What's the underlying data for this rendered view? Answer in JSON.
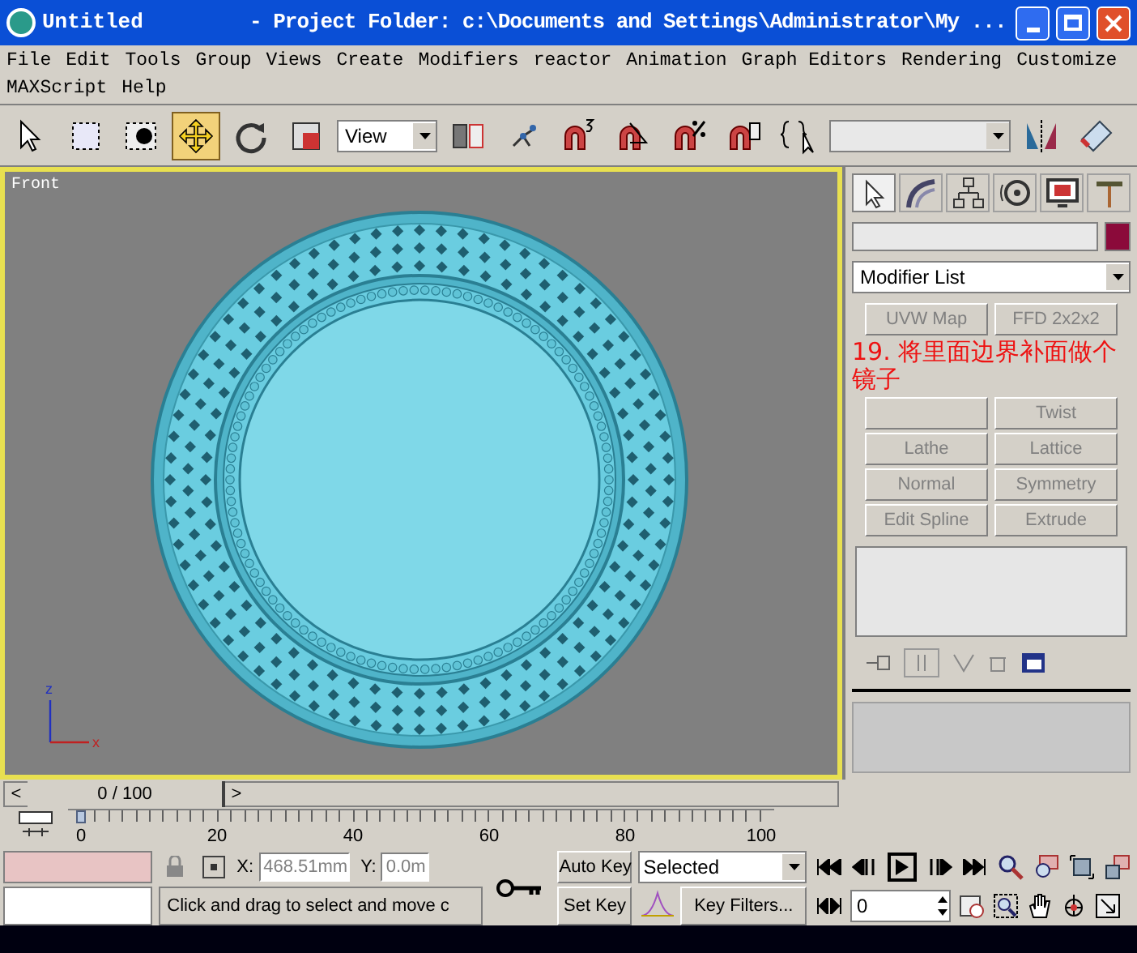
{
  "window": {
    "title": "Untitled",
    "project_folder": "- Project Folder: c:\\Documents and Settings\\Administrator\\My ..."
  },
  "menu_rows": [
    [
      "File",
      "Edit",
      "Tools",
      "Group",
      "Views",
      "Create",
      "Modifiers",
      "reactor",
      "Animation",
      "Graph Editors",
      "Rendering",
      "Customize"
    ],
    [
      "MAXScript",
      "Help"
    ]
  ],
  "toolbar": {
    "tools": [
      {
        "kind": "select",
        "selected": false
      },
      {
        "kind": "region",
        "selected": false
      },
      {
        "kind": "by-name",
        "selected": false
      },
      {
        "kind": "move",
        "selected": true
      },
      {
        "kind": "rotate",
        "selected": false
      },
      {
        "kind": "scale",
        "selected": false
      },
      {
        "kind": "coord"
      },
      {
        "kind": "pivot",
        "selected": false
      },
      {
        "kind": "link",
        "selected": false
      },
      {
        "kind": "snap3",
        "selected": false
      },
      {
        "kind": "angle-snap",
        "selected": false
      },
      {
        "kind": "percent-snap",
        "selected": false
      },
      {
        "kind": "spinner-snap",
        "selected": false
      },
      {
        "kind": "named-sets",
        "selected": false
      },
      {
        "kind": "named-field"
      },
      {
        "kind": "mirror",
        "selected": false
      },
      {
        "kind": "align",
        "selected": false
      }
    ],
    "coordinate_system": "View"
  },
  "viewport": {
    "label": "Front",
    "active": true,
    "axis": {
      "vertical": "z",
      "horizontal": "x"
    }
  },
  "command_panel": {
    "tabs": [
      {
        "kind": "create",
        "selected": true
      },
      {
        "kind": "modify",
        "selected": false
      },
      {
        "kind": "hierarchy",
        "selected": false
      },
      {
        "kind": "motion",
        "selected": false
      },
      {
        "kind": "display",
        "selected": false
      },
      {
        "kind": "utilities",
        "selected": false
      }
    ],
    "modifier_list": "Modifier List",
    "modifier_buttons": [
      "UVW Map",
      "FFD 2x2x2",
      "Twist",
      "Lathe",
      "Lattice",
      "Normal",
      "Symmetry",
      "Edit Spline",
      "Extrude"
    ]
  },
  "annotation": "19. 将里面边界补面做个镜子",
  "time_slider": {
    "prev": "<",
    "reading": "0 / 100",
    "next": ">"
  },
  "track_bar": {
    "labels": [
      "0",
      "20",
      "40",
      "60",
      "80",
      "100"
    ],
    "level": 0
  },
  "status": {
    "x_label": "X:",
    "x": "468.51mm",
    "y_label": "Y:",
    "y": "0.0m",
    "prompt": "Click and drag to select and move c",
    "auto_key": {
      "label": "Auto Key",
      "on": false
    },
    "set_key": "Set Key",
    "key_mode": "Selected",
    "key_filters": "Key Filters...",
    "frame": "0"
  }
}
